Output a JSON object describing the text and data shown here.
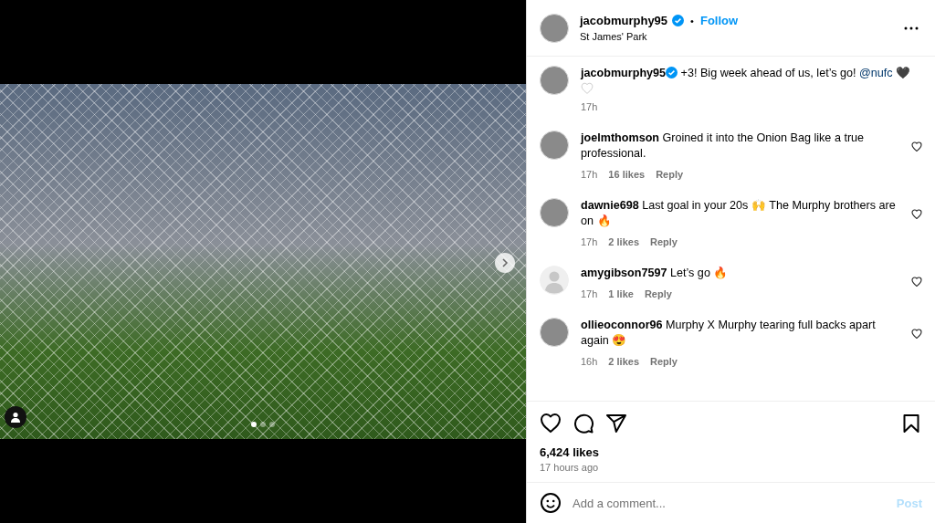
{
  "media": {
    "slides": [
      {
        "selected": true
      },
      {
        "selected": false
      },
      {
        "selected": false
      }
    ]
  },
  "header": {
    "username": "jacobmurphy95",
    "verified": true,
    "separator": "•",
    "follow": "Follow",
    "location": "St James' Park"
  },
  "caption": {
    "username": "jacobmurphy95",
    "verified": true,
    "text": "+3! Big week ahead of us, let’s go!",
    "mention": "@nufc",
    "end": "🖤",
    "time": "17h"
  },
  "comments": [
    {
      "kind": "photo",
      "username": "joelmthomson",
      "text": "Groined it into the Onion Bag like a true professional.",
      "time": "17h",
      "likes": "16 likes",
      "reply": "Reply"
    },
    {
      "kind": "photo",
      "username": "dawnie698",
      "text": "Last goal in your 20s 🙌 The Murphy brothers are on 🔥",
      "time": "17h",
      "likes": "2 likes",
      "reply": "Reply"
    },
    {
      "kind": "default",
      "username": "amygibson7597",
      "text": "Let’s go 🔥",
      "time": "17h",
      "likes": "1 like",
      "reply": "Reply"
    },
    {
      "kind": "photo",
      "username": "ollieoconnor96",
      "text": "Murphy X Murphy tearing full backs apart again 😍",
      "time": "16h",
      "likes": "2 likes",
      "reply": "Reply"
    }
  ],
  "likes": "6,424 likes",
  "posted": "17 hours ago",
  "comment_box": {
    "placeholder": "Add a comment...",
    "post": "Post",
    "disabled": true
  }
}
